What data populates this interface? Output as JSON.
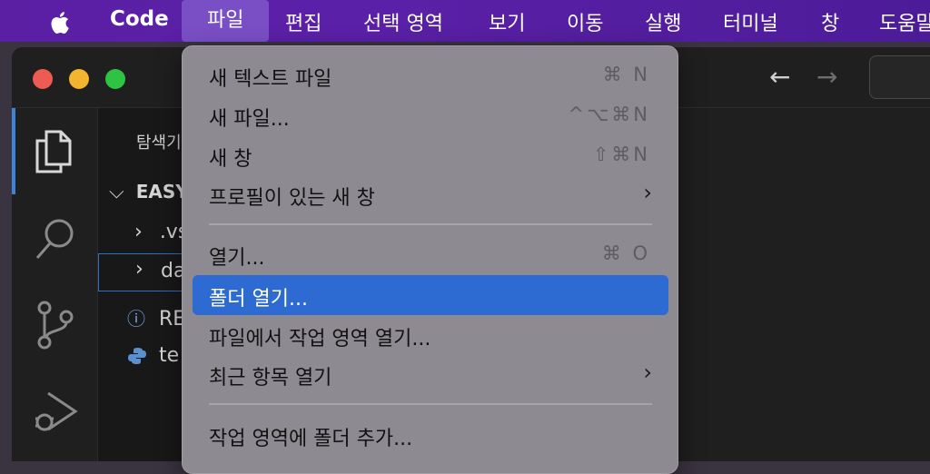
{
  "menubar": {
    "app_name": "Code",
    "items": [
      "파일",
      "편집",
      "선택 영역",
      "보기",
      "이동",
      "실행",
      "터미널",
      "창",
      "도움말"
    ],
    "active_index": 0
  },
  "sidebar": {
    "title": "탐색기",
    "workspace": "EASY",
    "rows": [
      ".vs",
      "da",
      "RE",
      "te"
    ]
  },
  "file_menu": {
    "items": [
      {
        "label": "새 텍스트 파일",
        "shortcut": "⌘ N"
      },
      {
        "label": "새 파일...",
        "shortcut": "^⌥⌘N"
      },
      {
        "label": "새 창",
        "shortcut": "⇧⌘N"
      },
      {
        "label": "프로필이 있는 새 창",
        "submenu": "›"
      },
      {
        "label": "열기...",
        "shortcut": "⌘ O"
      },
      {
        "label": "폴더 열기...",
        "highlighted": true
      },
      {
        "label": "파일에서 작업 영역 열기..."
      },
      {
        "label": "최근 항목 열기",
        "submenu": "›"
      },
      {
        "label": "작업 영역에 폴더 추가..."
      }
    ]
  },
  "colors": {
    "menubar": "#5a1fa3",
    "highlight": "#2d6ad1",
    "traffic_red": "#ee5b52",
    "traffic_yellow": "#f3b52f",
    "traffic_green": "#2ec443"
  }
}
